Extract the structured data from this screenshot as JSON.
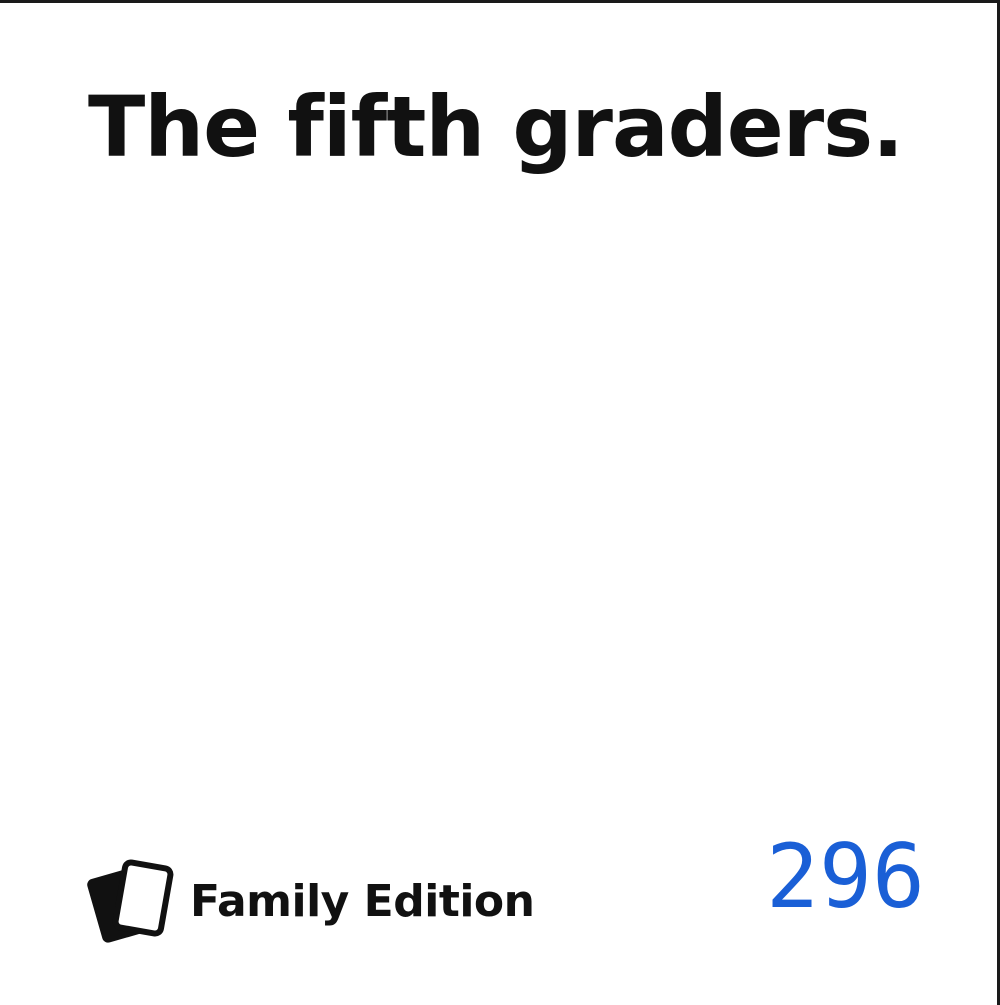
{
  "card": {
    "text": "The fifth graders.",
    "brand": {
      "logo_icon": "stacked-cards-icon",
      "name": "Family Edition"
    },
    "number": "296",
    "colors": {
      "text": "#111111",
      "number": "#1a5fd6",
      "border": "#1a1a1a",
      "background": "#ffffff"
    }
  }
}
